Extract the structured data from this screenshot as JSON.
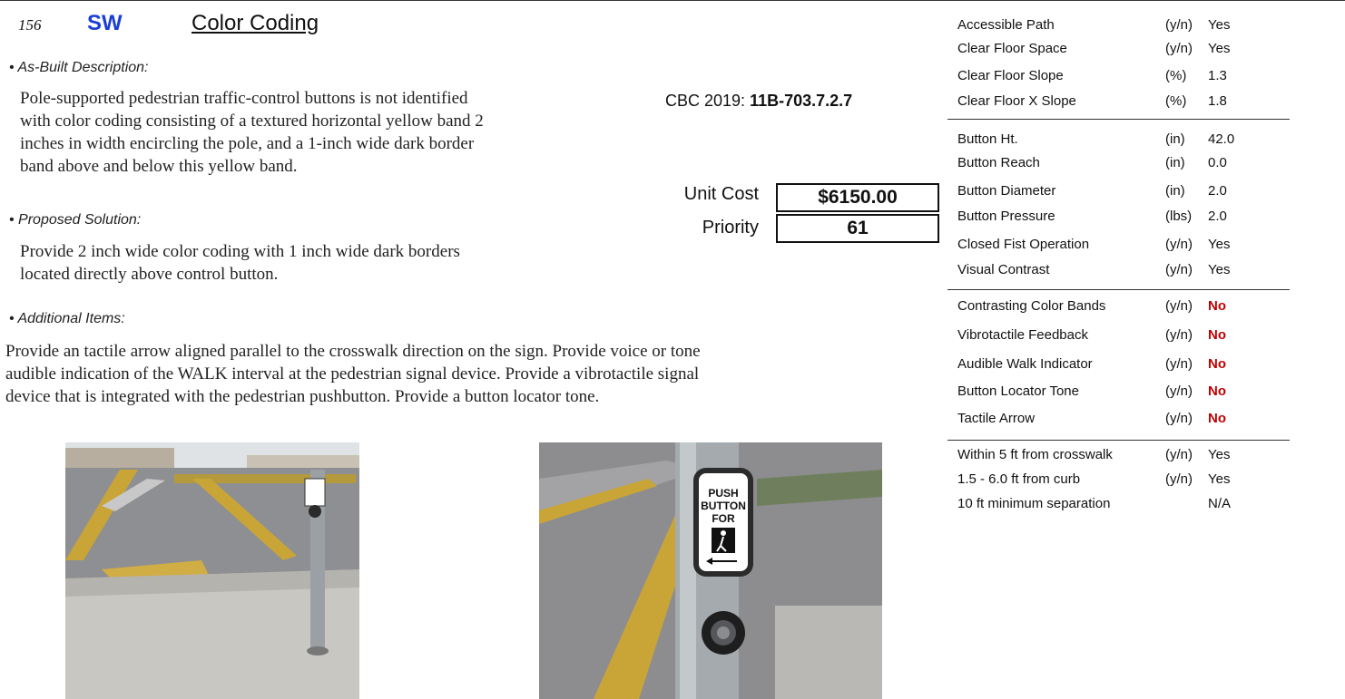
{
  "header": {
    "item_number": "156",
    "location_code": "SW",
    "title": "Color Coding"
  },
  "as_built": {
    "label": "• As-Built Description:",
    "lines": [
      "Pole-supported pedestrian traffic-control buttons is not identified",
      "with color coding consisting of a textured horizontal yellow band 2",
      "inches in width encircling the pole, and a 1-inch wide dark border",
      "band above and below this yellow band."
    ]
  },
  "proposed": {
    "label": "• Proposed Solution:",
    "lines": [
      "Provide 2 inch wide color coding with 1 inch wide dark borders",
      "located directly above control button."
    ]
  },
  "additional": {
    "label": "•  Additional Items:",
    "lines": [
      "Provide an tactile arrow aligned parallel to the crosswalk direction on the sign. Provide voice or tone",
      "audible indication of the WALK interval at the pedestrian signal device. Provide a vibrotactile signal",
      "device that is integrated with the pedestrian pushbutton. Provide a button locator tone."
    ]
  },
  "code": {
    "prefix": "CBC 2019:",
    "section": "11B-703.7.2.7"
  },
  "cost": {
    "unit_cost_label": "Unit Cost",
    "unit_cost": "$6150.00",
    "priority_label": "Priority",
    "priority": "61"
  },
  "sign_text": {
    "line1": "PUSH",
    "line2": "BUTTON",
    "line3": "FOR"
  },
  "colors": {
    "no_value": "#c00000",
    "location_code": "#1a3fd6",
    "sign_yellow": "#d9b43a"
  },
  "checklist": [
    {
      "label": "Accessible Path",
      "unit": "(y/n)",
      "value": "Yes"
    },
    {
      "label": "Clear Floor Space",
      "unit": "(y/n)",
      "value": "Yes"
    },
    {
      "label": "Clear Floor Slope",
      "unit": "(%)",
      "value": "1.3"
    },
    {
      "label": "Clear Floor X Slope",
      "unit": "(%)",
      "value": "1.8"
    },
    {
      "label": "Button Ht.",
      "unit": "(in)",
      "value": "42.0"
    },
    {
      "label": "Button Reach",
      "unit": "(in)",
      "value": "0.0"
    },
    {
      "label": "Button Diameter",
      "unit": "(in)",
      "value": "2.0"
    },
    {
      "label": "Button Pressure",
      "unit": "(lbs)",
      "value": "2.0"
    },
    {
      "label": "Closed Fist Operation",
      "unit": "(y/n)",
      "value": "Yes"
    },
    {
      "label": "Visual Contrast",
      "unit": "(y/n)",
      "value": "Yes"
    },
    {
      "label": "Contrasting Color Bands",
      "unit": "(y/n)",
      "value": "No"
    },
    {
      "label": "Vibrotactile Feedback",
      "unit": "(y/n)",
      "value": "No"
    },
    {
      "label": "Audible Walk Indicator",
      "unit": "(y/n)",
      "value": "No"
    },
    {
      "label": "Button Locator Tone",
      "unit": "(y/n)",
      "value": "No"
    },
    {
      "label": "Tactile Arrow",
      "unit": "(y/n)",
      "value": "No"
    },
    {
      "label": "Within 5 ft from crosswalk",
      "unit": "(y/n)",
      "value": "Yes"
    },
    {
      "label": "1.5 - 6.0 ft from curb",
      "unit": "(y/n)",
      "value": "Yes"
    },
    {
      "label": "10 ft minimum separation",
      "unit": "",
      "value": "N/A"
    }
  ]
}
